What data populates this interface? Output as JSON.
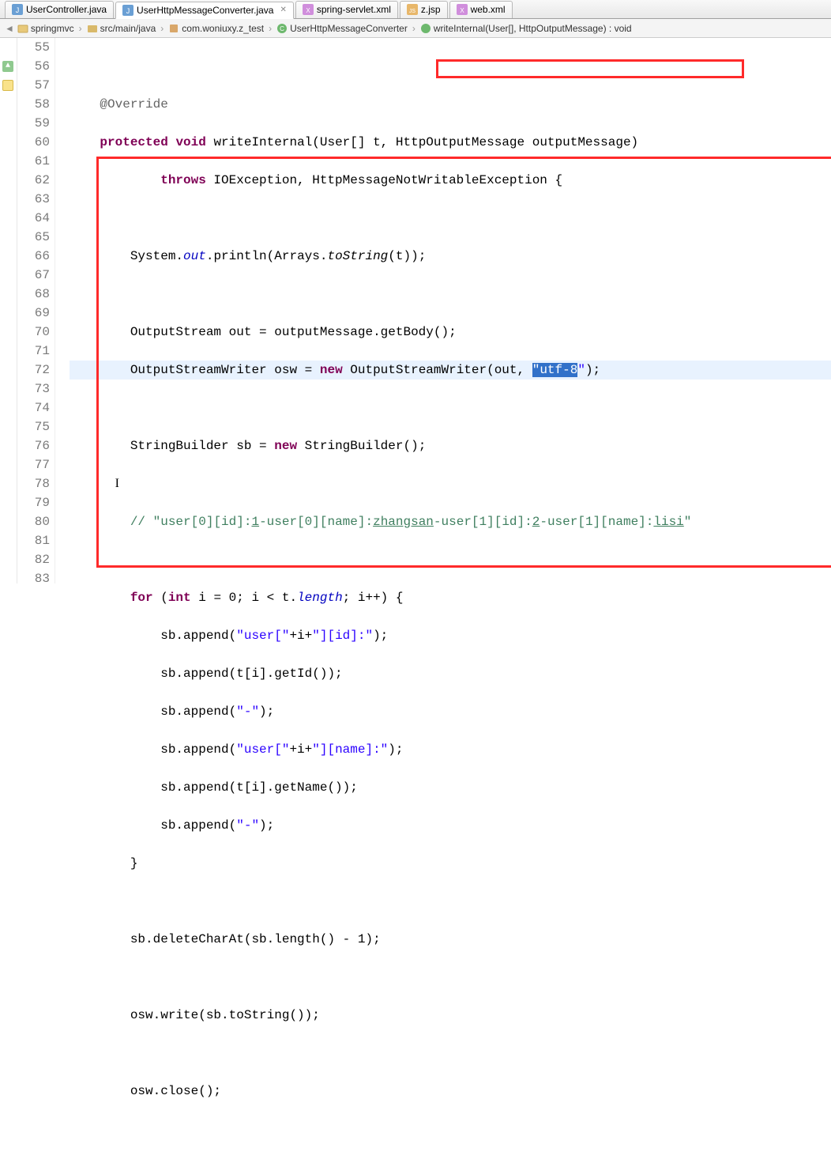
{
  "tabs": [
    {
      "label": "UserController.java",
      "icon": "java-file"
    },
    {
      "label": "UserHttpMessageConverter.java",
      "icon": "java-file",
      "active": true
    },
    {
      "label": "spring-servlet.xml",
      "icon": "xml-file"
    },
    {
      "label": "z.jsp",
      "icon": "jsp-file"
    },
    {
      "label": "web.xml",
      "icon": "xml-file"
    }
  ],
  "breadcrumb": {
    "items": [
      {
        "label": "springmvc",
        "icon": "project"
      },
      {
        "label": "src/main/java",
        "icon": "src-folder"
      },
      {
        "label": "com.woniuxy.z_test",
        "icon": "package"
      },
      {
        "label": "UserHttpMessageConverter",
        "icon": "class"
      },
      {
        "label": "writeInternal(User[], HttpOutputMessage) : void",
        "icon": "method"
      }
    ]
  },
  "gutter": {
    "start": 55,
    "end": 83
  },
  "code": {
    "l55": "",
    "l56_ann": "@Override",
    "l57_kw1": "protected",
    "l57_kw2": "void",
    "l57_name": " writeInternal(User[] t, ",
    "l57_param": "HttpOutputMessage outputMessage",
    "l57_close": ")",
    "l58_kw": "throws",
    "l58_rest": " IOException, HttpMessageNotWritableException {",
    "l60_a": "System.",
    "l60_out": "out",
    "l60_b": ".println(Arrays.",
    "l60_ts": "toString",
    "l60_c": "(t));",
    "l62": "OutputStream out = outputMessage.getBody();",
    "l63_a": "OutputStreamWriter osw = ",
    "l63_new": "new",
    "l63_b": " OutputStreamWriter(out, ",
    "l63_sel": "\"utf-8",
    "l63_q": "\"",
    "l63_end": ");",
    "l65_a": "StringBuilder sb = ",
    "l65_new": "new",
    "l65_b": " StringBuilder();",
    "l66_caret": "I",
    "l67_a": "// ",
    "l67_q1": "\"user[0][id]:",
    "l67_v1": "1",
    "l67_d1": "-user[0][name]:",
    "l67_v2": "zhangsan",
    "l67_d2": "-user[1][id]:",
    "l67_v3": "2",
    "l67_d3": "-user[1][name]:",
    "l67_v4": "lisi",
    "l67_q2": "\"",
    "l69_for": "for",
    "l69_a": " (",
    "l69_int": "int",
    "l69_b": " i = 0; i < t.",
    "l69_len": "length",
    "l69_c": "; i++) {",
    "l70_a": "sb.append(",
    "l70_s1": "\"user[\"",
    "l70_b": "+i+",
    "l70_s2": "\"][id]:\"",
    "l70_c": ");",
    "l71": "sb.append(t[i].getId());",
    "l72_a": "sb.append(",
    "l72_s": "\"-\"",
    "l72_b": ");",
    "l73_a": "sb.append(",
    "l73_s1": "\"user[\"",
    "l73_b": "+i+",
    "l73_s2": "\"][name]:\"",
    "l73_c": ");",
    "l74": "sb.append(t[i].getName());",
    "l75_a": "sb.append(",
    "l75_s": "\"-\"",
    "l75_b": ");",
    "l76": "}",
    "l78": "sb.deleteCharAt(sb.length() - 1);",
    "l80": "osw.write(sb.toString());",
    "l82": "osw.close();"
  }
}
